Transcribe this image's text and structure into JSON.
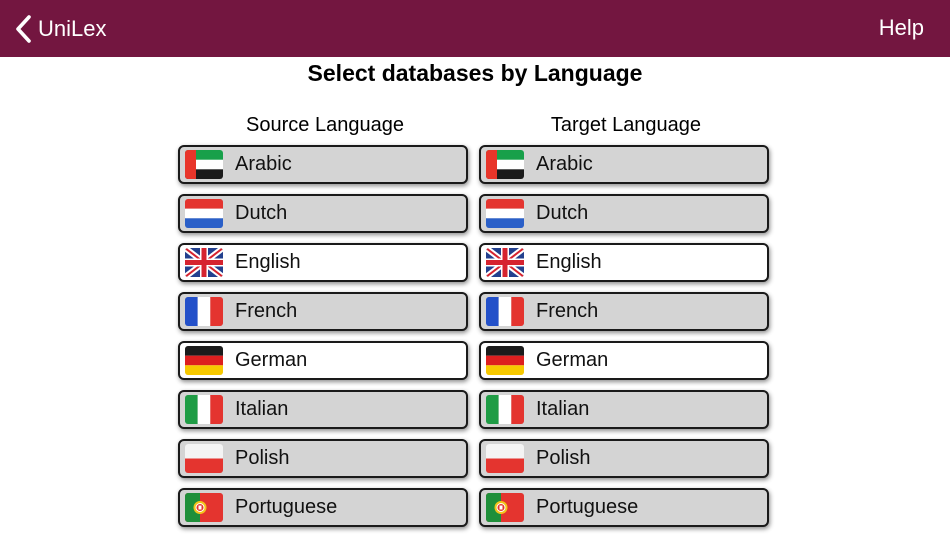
{
  "navbar": {
    "back_label": "UniLex",
    "help_label": "Help",
    "background": "#731640"
  },
  "page_title": "Select databases by Language",
  "source": {
    "header": "Source Language",
    "languages": [
      {
        "label": "Arabic",
        "flag": "uae-flag-icon",
        "selected": false
      },
      {
        "label": "Dutch",
        "flag": "netherlands-flag-icon",
        "selected": false
      },
      {
        "label": "English",
        "flag": "uk-flag-icon",
        "selected": true
      },
      {
        "label": "French",
        "flag": "france-flag-icon",
        "selected": false
      },
      {
        "label": "German",
        "flag": "germany-flag-icon",
        "selected": true
      },
      {
        "label": "Italian",
        "flag": "italy-flag-icon",
        "selected": false
      },
      {
        "label": "Polish",
        "flag": "poland-flag-icon",
        "selected": false
      },
      {
        "label": "Portuguese",
        "flag": "portugal-flag-icon",
        "selected": false
      }
    ]
  },
  "target": {
    "header": "Target Language",
    "languages": [
      {
        "label": "Arabic",
        "flag": "uae-flag-icon",
        "selected": false
      },
      {
        "label": "Dutch",
        "flag": "netherlands-flag-icon",
        "selected": false
      },
      {
        "label": "English",
        "flag": "uk-flag-icon",
        "selected": true
      },
      {
        "label": "French",
        "flag": "france-flag-icon",
        "selected": false
      },
      {
        "label": "German",
        "flag": "germany-flag-icon",
        "selected": true
      },
      {
        "label": "Italian",
        "flag": "italy-flag-icon",
        "selected": false
      },
      {
        "label": "Polish",
        "flag": "poland-flag-icon",
        "selected": false
      },
      {
        "label": "Portuguese",
        "flag": "portugal-flag-icon",
        "selected": false
      }
    ]
  },
  "colors": {
    "button_default": "#d4d4d4",
    "button_selected": "#ffffff",
    "button_border": "#1a1a1a"
  }
}
